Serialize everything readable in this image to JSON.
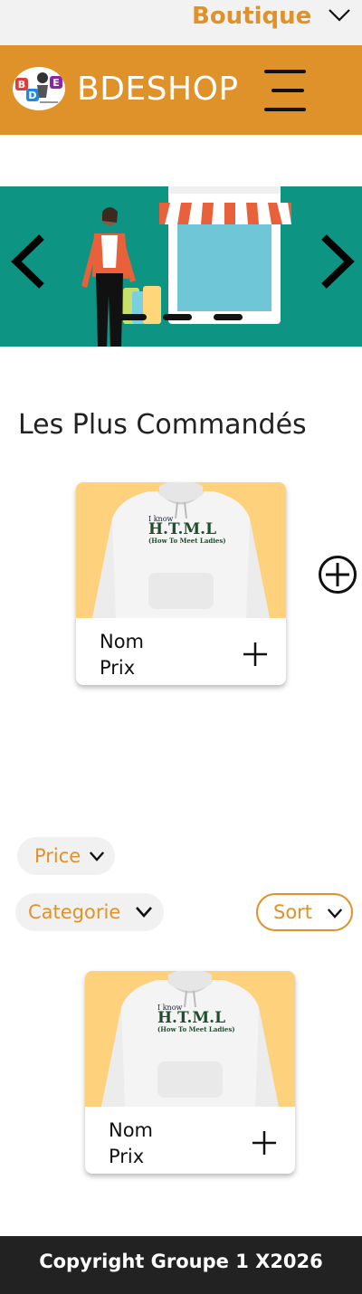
{
  "topbar": {
    "label": "Boutique"
  },
  "header": {
    "brand": "BDESHOP",
    "logo_text": "BDE"
  },
  "hero": {
    "slide_count": 3,
    "active_slide": 1
  },
  "section": {
    "title": "Les Plus Commandés"
  },
  "featured_product": {
    "shirt_line1": "I know",
    "shirt_line2": "H.T.M.L",
    "shirt_line3": "(How To Meet Ladies)",
    "name": "Nom",
    "price": "Prix"
  },
  "filters": {
    "price_label": "Price",
    "category_label": "Categorie",
    "sort_label": "Sort"
  },
  "product": {
    "shirt_line1": "I know",
    "shirt_line2": "H.T.M.L",
    "shirt_line3": "(How To Meet Ladies)",
    "name": "Nom",
    "price": "Prix"
  },
  "footer": {
    "copyright": "Copyright Groupe 1 X2026"
  },
  "colors": {
    "accent": "#e0922a",
    "hero_bg": "#0e9482",
    "footer_bg": "#222222",
    "card_image_bg": "#fed17d"
  }
}
